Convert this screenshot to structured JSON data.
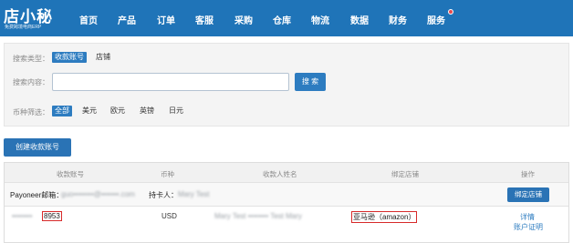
{
  "header": {
    "logo_title": "店小秘",
    "logo_subtitle": "免费跨境电商ERP",
    "nav": [
      "首页",
      "产品",
      "订单",
      "客服",
      "采购",
      "仓库",
      "物流",
      "数据",
      "财务",
      "服务"
    ]
  },
  "search": {
    "type_label": "搜索类型：",
    "type_options": [
      "收款账号",
      "店铺"
    ],
    "content_label": "搜索内容：",
    "content_value": "",
    "search_button": "搜 索",
    "currency_label": "币种筛选：",
    "currency_options": [
      "全部",
      "美元",
      "欧元",
      "英镑",
      "日元"
    ]
  },
  "create_button": "创建收款账号",
  "table": {
    "headers": [
      "收款账号",
      "币种",
      "收款人姓名",
      "绑定店铺",
      "操作"
    ],
    "group": {
      "account_label": "Payoneer邮箱：",
      "account_value": "guo••••••••@•••••••.com",
      "holder_label": "持卡人：",
      "holder_value": "Mary Test",
      "bind_button": "绑定店铺"
    },
    "row": {
      "account_masked": "••••••••",
      "account_suffix": "8953",
      "currency": "USD",
      "payee_name": "Mary Test •••••••• Test Mary",
      "store": "亚马逊（amazon）",
      "actions": [
        "详情",
        "账户证明"
      ]
    }
  },
  "colors": {
    "nav_bg": "#1f74b8",
    "primary": "#2d7cc0",
    "highlight_box": "#d72a2a",
    "notify_dot": "#e8494c"
  }
}
